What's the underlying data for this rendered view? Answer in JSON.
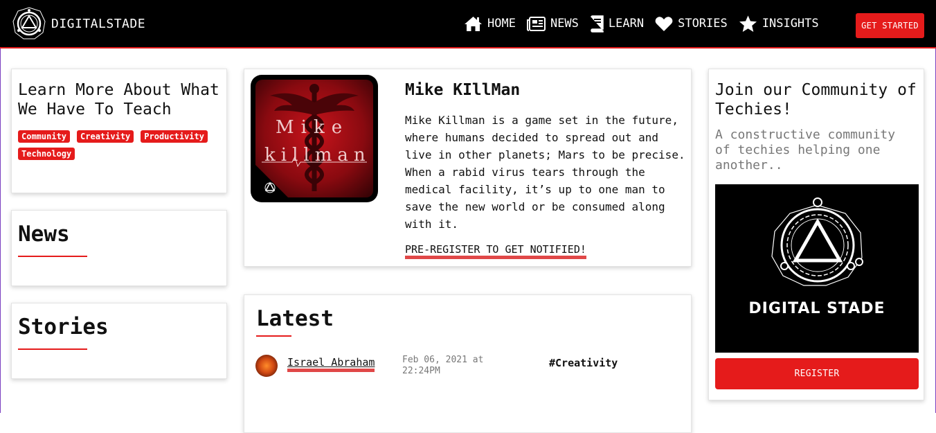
{
  "brand": {
    "name": "DIGITALSTADE",
    "logo_icon": "digitalstade-logo-icon"
  },
  "nav": {
    "items": [
      {
        "label": "HOME",
        "icon": "home-icon"
      },
      {
        "label": "NEWS",
        "icon": "newspaper-icon"
      },
      {
        "label": "LEARN",
        "icon": "book-icon"
      },
      {
        "label": "STORIES",
        "icon": "heart-icon"
      },
      {
        "label": "INSIGHTS",
        "icon": "star-icon"
      }
    ],
    "cta": "GET STARTED"
  },
  "learn": {
    "title": "Learn More About What We Have To Teach",
    "tags": [
      "Community",
      "Creativity",
      "Productivity",
      "Technology"
    ]
  },
  "news": {
    "title": "News"
  },
  "stories": {
    "title": "Stories"
  },
  "feature": {
    "title": "Mike KIllMan",
    "description": "Mike Killman is a game set in the future, where humans decided to spread out and live in other planets; Mars to be precise. When a rabid virus tears through the medical facility, it’s up to one man to save the new world or be consumed along with it.",
    "link": "PRE-REGISTER TO GET NOTIFIED!",
    "image_text_top": "Mike",
    "image_text_bottom": "killman"
  },
  "latest": {
    "title": "Latest",
    "posts": [
      {
        "author": "Israel Abraham",
        "date": "Feb 06, 2021 at 22:24PM",
        "tag": "#Creativity"
      }
    ]
  },
  "community": {
    "title": "Join our Community of Techies!",
    "subtitle": "A constructive community of techies helping one another..",
    "image_text": "DIGITAL STADE",
    "button": "REGISTER"
  },
  "colors": {
    "accent": "#e51b1b",
    "header_bg": "#000000",
    "muted_text": "#777777"
  }
}
